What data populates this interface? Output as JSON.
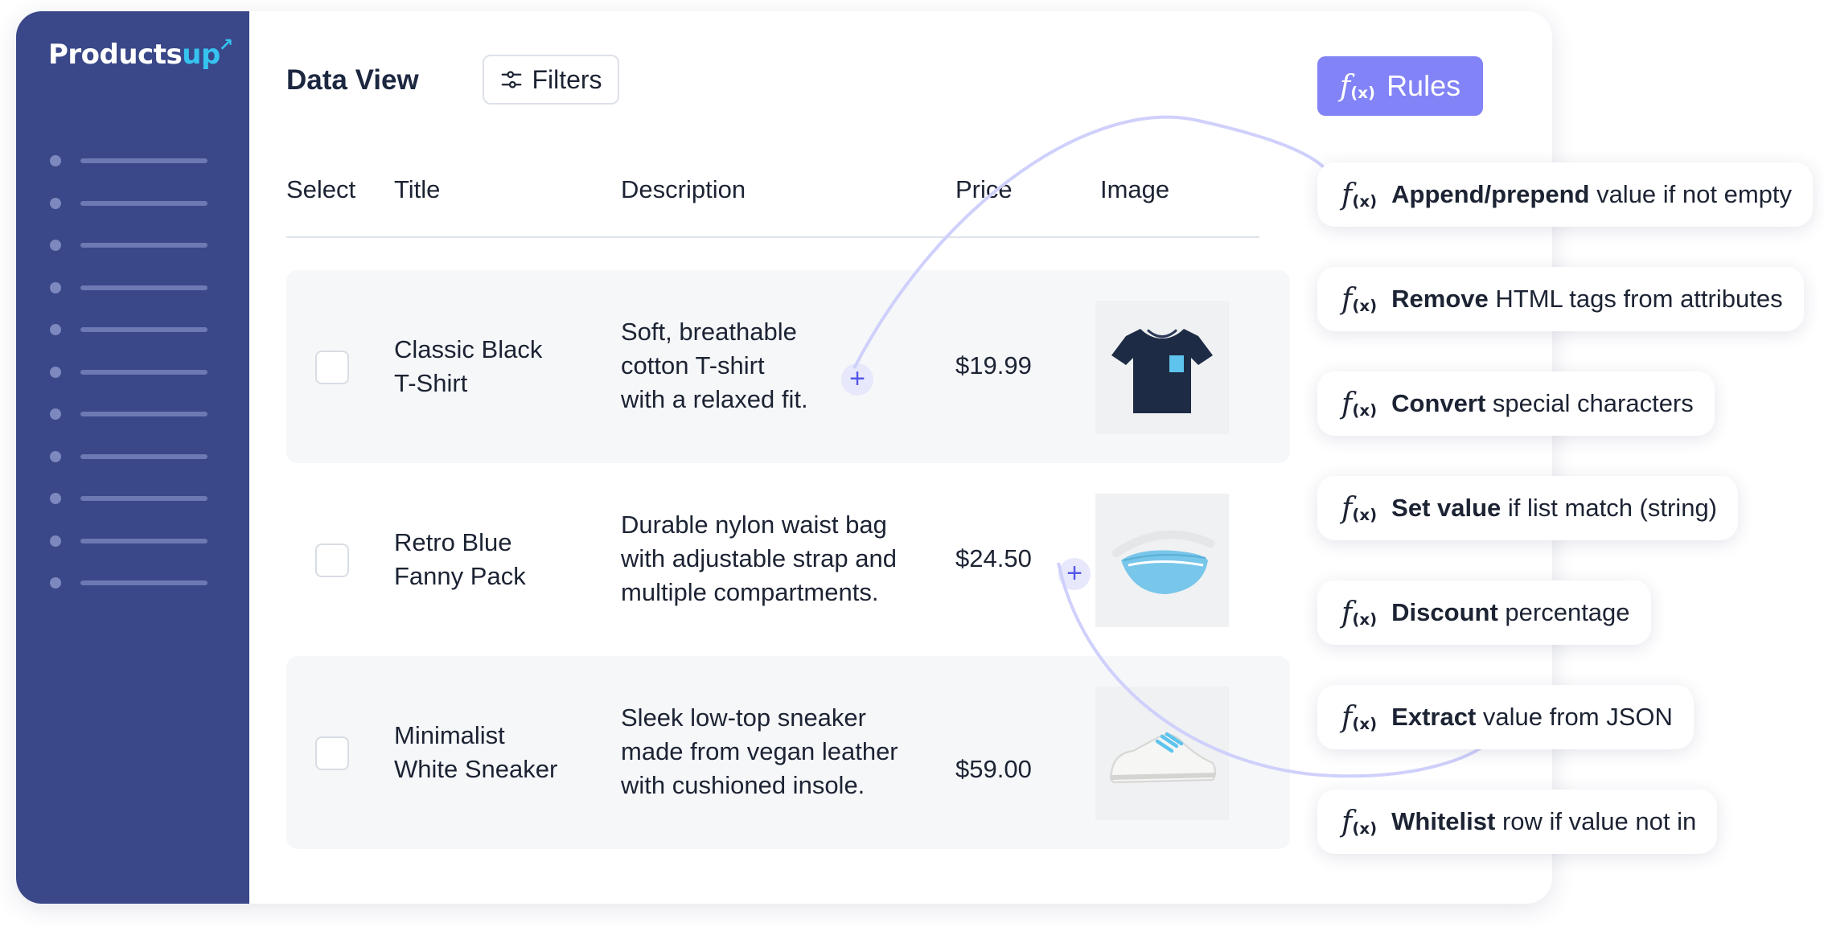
{
  "sidebar": {
    "logo_main": "Products",
    "logo_accent": "up",
    "nav_item_count": 11
  },
  "header": {
    "title": "Data View",
    "filters_label": "Filters"
  },
  "table": {
    "columns": [
      "Select",
      "Title",
      "Description",
      "Price",
      "Image"
    ],
    "rows": [
      {
        "title_line1": "Classic Black",
        "title_line2": "T-Shirt",
        "desc_line1": "Soft, breathable",
        "desc_line2": "cotton T-shirt",
        "desc_line3": "with a relaxed fit.",
        "price": "$19.99",
        "image": "t-shirt-image"
      },
      {
        "title_line1": "Retro Blue",
        "title_line2": "Fanny Pack",
        "desc_line1": "Durable nylon waist bag",
        "desc_line2": "with adjustable strap and",
        "desc_line3": "multiple compartments.",
        "price": "$24.50",
        "image": "fanny-pack-image"
      },
      {
        "title_line1": "Minimalist",
        "title_line2": "White Sneaker",
        "desc_line1": "Sleek low-top sneaker",
        "desc_line2": "made from vegan leather",
        "desc_line3": "with cushioned insole.",
        "price": "$59.00",
        "image": "sneaker-image"
      }
    ]
  },
  "rules": {
    "button_label": "Rules",
    "fx_symbol": "f",
    "fx_sub": "(x)",
    "items": [
      {
        "bold": "Append/prepend",
        "rest": " value if not empty"
      },
      {
        "bold": "Remove",
        "rest": " HTML tags from attributes"
      },
      {
        "bold": "Convert",
        "rest": " special characters"
      },
      {
        "bold": "Set value",
        "rest": " if list match (string)"
      },
      {
        "bold": "Discount",
        "rest": " percentage"
      },
      {
        "bold": "Extract",
        "rest": " value from JSON"
      },
      {
        "bold": "Whitelist",
        "rest": " row if value not in"
      }
    ]
  },
  "colors": {
    "sidebar": "#3a4788",
    "accent": "#8283f6",
    "logo_accent": "#36c3ef",
    "plus": "#5558e8"
  }
}
